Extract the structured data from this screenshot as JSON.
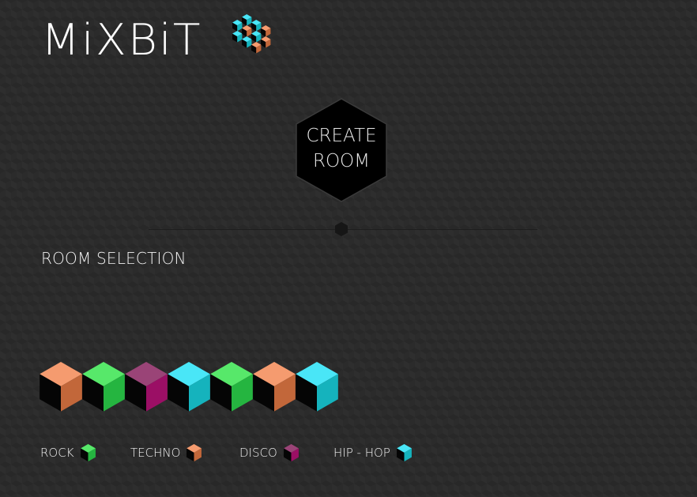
{
  "logo": {
    "text": "MiXBiT"
  },
  "create_button": {
    "line1": "CREATE",
    "line2": "ROOM"
  },
  "section": {
    "title": "ROOM SELECTION"
  },
  "colors": {
    "orange_top": "#f59b6f",
    "orange_side": "#c2673a",
    "green_top": "#57e86a",
    "green_side": "#25b540",
    "magenta_top": "#9a4477",
    "magenta_side": "#9b0f65",
    "cyan_top": "#49e6f7",
    "cyan_side": "#15b3bd",
    "cube_shadow": "#050505"
  },
  "rooms": [
    {
      "genre": "orange"
    },
    {
      "genre": "green"
    },
    {
      "genre": "magenta"
    },
    {
      "genre": "cyan"
    },
    {
      "genre": "green"
    },
    {
      "genre": "orange"
    },
    {
      "genre": "cyan"
    }
  ],
  "legend": [
    {
      "label": "ROCK",
      "color": "green"
    },
    {
      "label": "TECHNO",
      "color": "orange"
    },
    {
      "label": "DISCO",
      "color": "magenta"
    },
    {
      "label": "HIP - HOP",
      "color": "cyan"
    }
  ]
}
